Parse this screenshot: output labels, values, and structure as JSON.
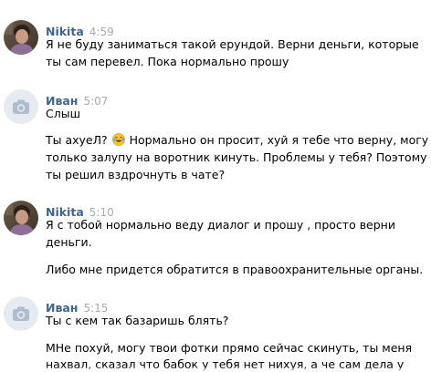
{
  "messages": [
    {
      "author": "Nikita",
      "time": "4:59",
      "avatar": "user-photo-avatar",
      "lines": [
        "Я не буду заниматься такой ерундой. Верни деньги, которые",
        "ты сам перевел. Пока нормально прошу"
      ]
    },
    {
      "author": "Иван",
      "time": "5:07",
      "avatar": "camera-placeholder-avatar",
      "line1": "Слыш",
      "line2_before": "Ты ахуеЛ? ",
      "line2_emoji": "laughing-tears-emoji",
      "line2_after": " Нормально он просит, хуй я тебе что верну, могу",
      "line3": "только залупу на воротник кинуть. Проблемы у тебя? Поэтому",
      "line4": "ты решил вздрочнуть в чате?"
    },
    {
      "author": "Nikita",
      "time": "5:10",
      "avatar": "user-photo-avatar",
      "lines": [
        "Я с тобой нормально веду диалог и прошу , просто верни",
        "деньги.",
        "Либо мне придется обратится в правоохранительные органы."
      ]
    },
    {
      "author": "Иван",
      "time": "5:15",
      "avatar": "camera-placeholder-avatar",
      "lines": [
        "Ты с кем так базаришь блять?",
        "МНе похуй, могу твои фотки прямо сейчас скинуть, ты меня",
        "нахвал, сказал что бабок у тебя нет нихуя, а че сам дела у"
      ]
    }
  ],
  "colors": {
    "author": "#42648b",
    "time": "#a5acb4",
    "text": "#000000",
    "placeholder_avatar_bg": "#e5ebf1",
    "placeholder_icon": "#aebed0"
  }
}
